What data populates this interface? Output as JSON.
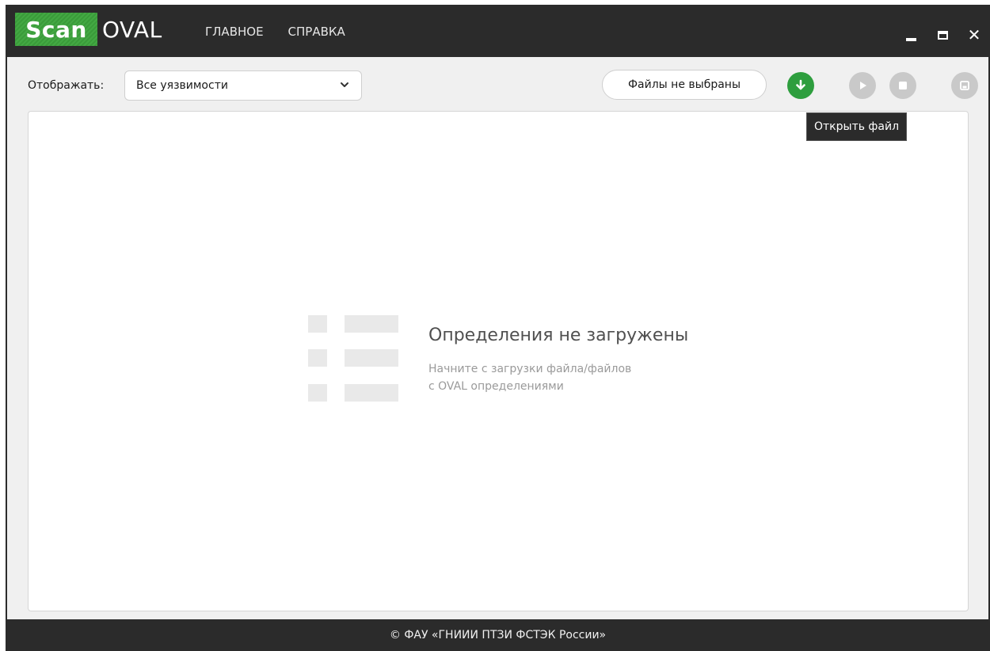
{
  "app": {
    "logo_scan": "Scan",
    "logo_oval": "OVAL"
  },
  "menu": {
    "items": [
      {
        "label": "ГЛАВНОЕ"
      },
      {
        "label": "СПРАВКА"
      }
    ]
  },
  "window_controls": {
    "close_glyph": "✕"
  },
  "toolbar": {
    "show_label": "Отображать:",
    "filter_value": "Все уязвимости",
    "files_label": "Файлы не выбраны",
    "tooltip": "Открыть файл"
  },
  "empty_state": {
    "title": "Определения не загружены",
    "subtitle_line1": "Начните с загрузки файла/файлов",
    "subtitle_line2": "с OVAL определениями"
  },
  "footer": {
    "text": "© ФАУ «ГНИИИ ПТЗИ ФСТЭК России»"
  },
  "colors": {
    "titlebar_bg": "#2b2b2b",
    "accent_green": "#2e9e3e",
    "disabled_grey": "#c9c9c9"
  },
  "icons": {
    "filter_dropdown": "chevron-down-icon",
    "open": "download-arrow-icon",
    "play": "play-icon",
    "stop": "stop-icon",
    "save": "save-icon",
    "minimize": "minimize-icon",
    "maximize": "maximize-icon",
    "close": "close-icon"
  }
}
